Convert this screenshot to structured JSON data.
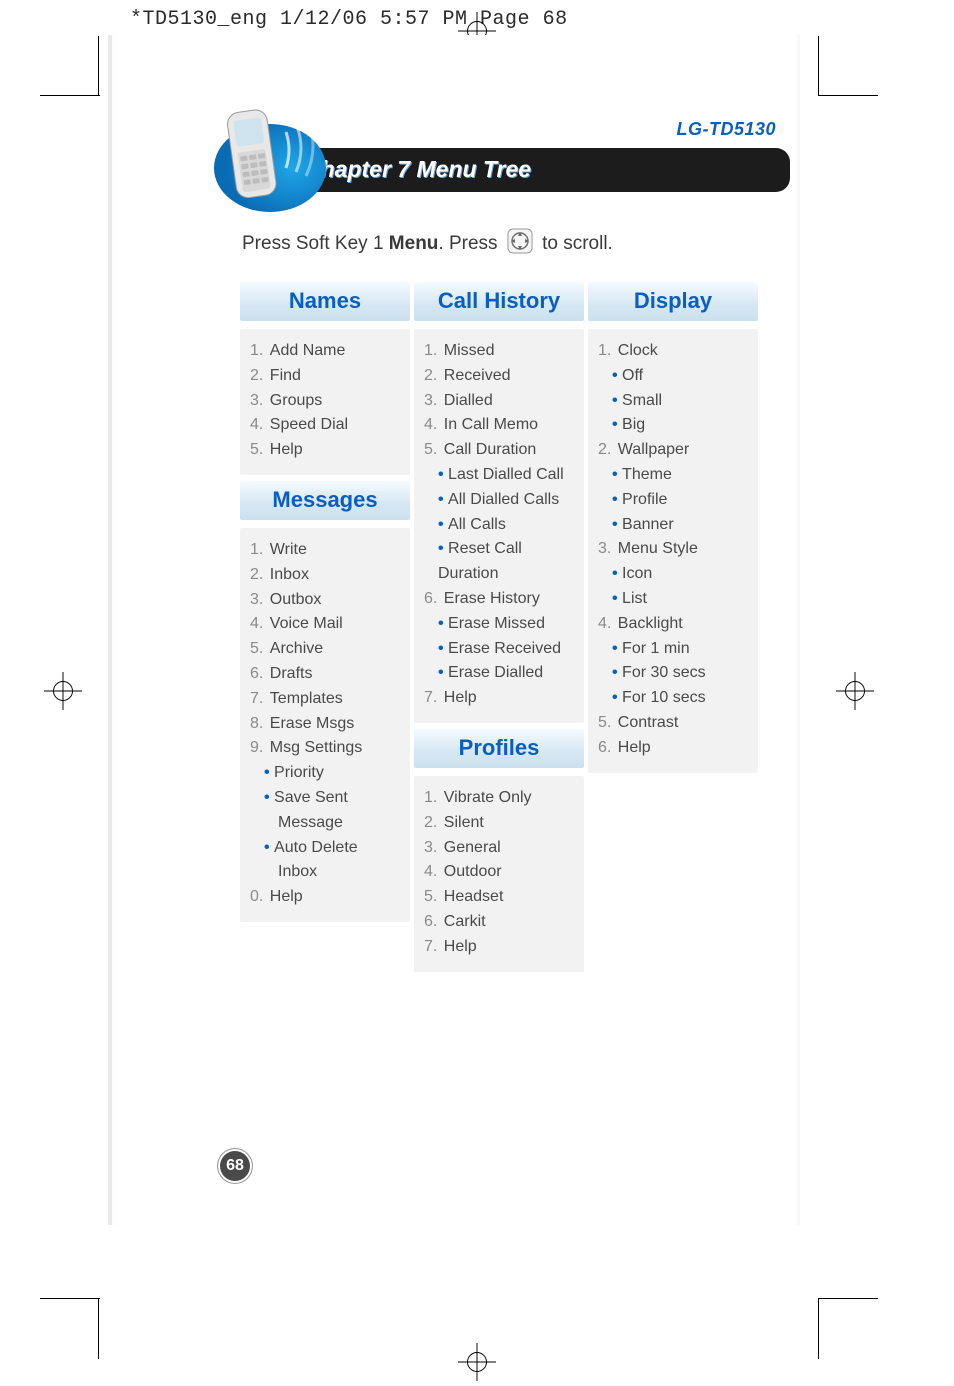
{
  "print_header": "*TD5130_eng  1/12/06  5:57 PM  Page 68",
  "model": "LG-TD5130",
  "chapter_title": "Chapter 7  Menu Tree",
  "instruction_pre": "Press Soft Key 1 ",
  "instruction_bold": "Menu",
  "instruction_mid": ". Press ",
  "instruction_post": " to scroll.",
  "page_number": "68",
  "col1": {
    "sections": [
      {
        "title": "Names",
        "rows": [
          {
            "t": "num",
            "n": "1.",
            "label": "Add Name"
          },
          {
            "t": "num",
            "n": "2.",
            "label": "Find"
          },
          {
            "t": "num",
            "n": "3.",
            "label": "Groups"
          },
          {
            "t": "num",
            "n": "4.",
            "label": "Speed Dial"
          },
          {
            "t": "num",
            "n": "5.",
            "label": "Help"
          }
        ]
      },
      {
        "title": "Messages",
        "rows": [
          {
            "t": "num",
            "n": "1.",
            "label": "Write"
          },
          {
            "t": "num",
            "n": "2.",
            "label": "Inbox"
          },
          {
            "t": "num",
            "n": "3.",
            "label": "Outbox"
          },
          {
            "t": "num",
            "n": "4.",
            "label": "Voice Mail"
          },
          {
            "t": "num",
            "n": "5.",
            "label": "Archive"
          },
          {
            "t": "num",
            "n": "6.",
            "label": "Drafts"
          },
          {
            "t": "num",
            "n": "7.",
            "label": "Templates"
          },
          {
            "t": "num",
            "n": "8.",
            "label": "Erase Msgs"
          },
          {
            "t": "num",
            "n": "9.",
            "label": "Msg Settings"
          },
          {
            "t": "sub",
            "label": "Priority"
          },
          {
            "t": "sub",
            "label": "Save Sent"
          },
          {
            "t": "cont",
            "label": "Message"
          },
          {
            "t": "sub",
            "label": "Auto Delete"
          },
          {
            "t": "cont",
            "label": "Inbox"
          },
          {
            "t": "num",
            "n": "0.",
            "label": "Help"
          }
        ]
      }
    ]
  },
  "col2": {
    "sections": [
      {
        "title": "Call History",
        "rows": [
          {
            "t": "num",
            "n": "1.",
            "label": "Missed"
          },
          {
            "t": "num",
            "n": "2.",
            "label": "Received"
          },
          {
            "t": "num",
            "n": "3.",
            "label": "Dialled"
          },
          {
            "t": "num",
            "n": "4.",
            "label": "In Call Memo"
          },
          {
            "t": "num",
            "n": "5.",
            "label": "Call Duration"
          },
          {
            "t": "sub",
            "label": "Last Dialled Call"
          },
          {
            "t": "sub",
            "label": "All Dialled Calls"
          },
          {
            "t": "sub",
            "label": "All Calls"
          },
          {
            "t": "sub",
            "label": "Reset Call Duration"
          },
          {
            "t": "num",
            "n": "6.",
            "label": "Erase History"
          },
          {
            "t": "sub",
            "label": "Erase Missed"
          },
          {
            "t": "sub",
            "label": "Erase Received"
          },
          {
            "t": "sub",
            "label": "Erase Dialled"
          },
          {
            "t": "num",
            "n": "7.",
            "label": "Help"
          }
        ]
      },
      {
        "title": "Profiles",
        "rows": [
          {
            "t": "num",
            "n": "1.",
            "label": "Vibrate Only"
          },
          {
            "t": "num",
            "n": "2.",
            "label": "Silent"
          },
          {
            "t": "num",
            "n": "3.",
            "label": "General"
          },
          {
            "t": "num",
            "n": "4.",
            "label": "Outdoor"
          },
          {
            "t": "num",
            "n": "5.",
            "label": "Headset"
          },
          {
            "t": "num",
            "n": "6.",
            "label": "Carkit"
          },
          {
            "t": "num",
            "n": "7.",
            "label": "Help"
          }
        ]
      }
    ]
  },
  "col3": {
    "sections": [
      {
        "title": "Display",
        "rows": [
          {
            "t": "num",
            "n": "1.",
            "label": "Clock"
          },
          {
            "t": "sub",
            "label": "Off"
          },
          {
            "t": "sub",
            "label": "Small"
          },
          {
            "t": "sub",
            "label": "Big"
          },
          {
            "t": "num",
            "n": "2.",
            "label": "Wallpaper"
          },
          {
            "t": "sub",
            "label": "Theme"
          },
          {
            "t": "sub",
            "label": "Profile"
          },
          {
            "t": "sub",
            "label": "Banner"
          },
          {
            "t": "num",
            "n": "3.",
            "label": "Menu Style"
          },
          {
            "t": "sub",
            "label": "Icon"
          },
          {
            "t": "sub",
            "label": "List"
          },
          {
            "t": "num",
            "n": "4.",
            "label": "Backlight"
          },
          {
            "t": "sub",
            "label": "For 1 min"
          },
          {
            "t": "sub",
            "label": "For 30 secs"
          },
          {
            "t": "sub",
            "label": "For 10 secs"
          },
          {
            "t": "num",
            "n": "5.",
            "label": "Contrast"
          },
          {
            "t": "num",
            "n": "6.",
            "label": "Help"
          }
        ]
      }
    ]
  }
}
